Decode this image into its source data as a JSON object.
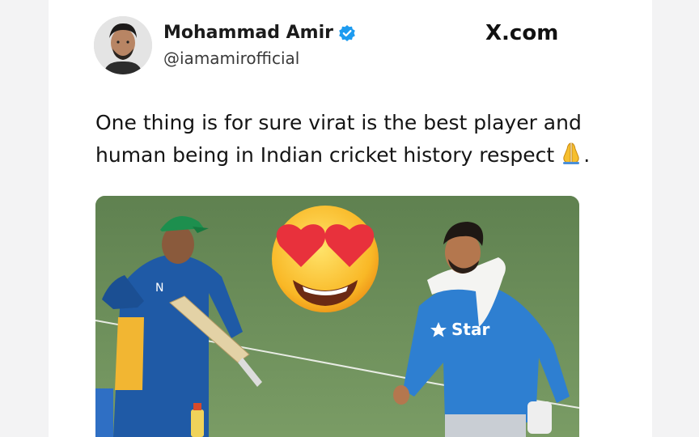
{
  "tweet": {
    "author_name": "Mohammad Amir",
    "author_handle": "@iamamirofficial",
    "platform": "X.com",
    "text": "One thing is for sure virat is the best player and human being in Indian cricket history respect",
    "text_suffix": ".",
    "emoji_icon": "folded-hands-icon"
  },
  "media": {
    "overlay_emoji": "heart-eyes-emoji-icon",
    "jersey_text": "Star",
    "left_jersey_letter": "N"
  },
  "colors": {
    "verified": "#1d9bf0",
    "grass": "#6a8d5b",
    "pakistan_jersey": "#1f5aa6",
    "india_jersey": "#2e7fd1"
  }
}
